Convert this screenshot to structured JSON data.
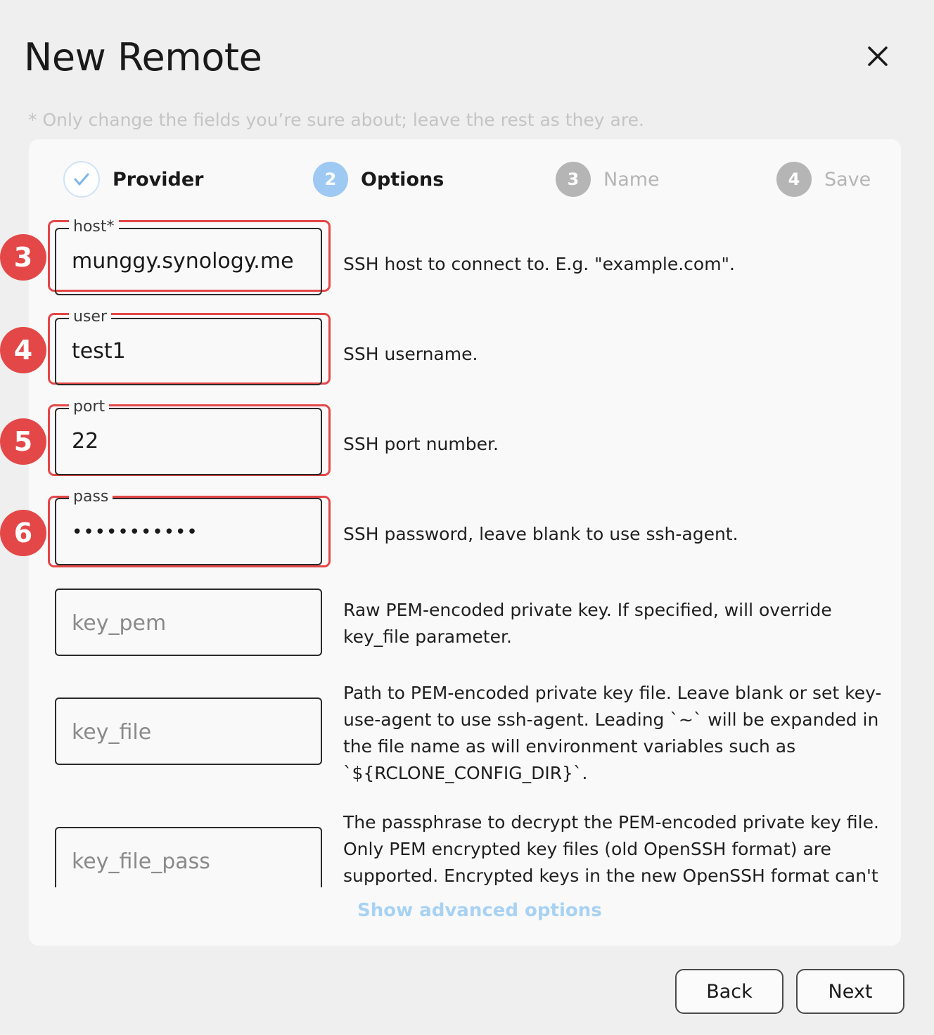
{
  "dialog": {
    "title": "New Remote",
    "hint": "* Only change the fields you’re sure about; leave the rest as they are."
  },
  "steps": [
    {
      "label": "Provider",
      "number": "",
      "state": "done"
    },
    {
      "label": "Options",
      "number": "2",
      "state": "active"
    },
    {
      "label": "Name",
      "number": "3",
      "state": "pending"
    },
    {
      "label": "Save",
      "number": "4",
      "state": "pending"
    }
  ],
  "fields": {
    "host": {
      "label": "host*",
      "value": "munggy.synology.me",
      "description": "SSH host to connect to.  E.g. \"example.com\"."
    },
    "user": {
      "label": "user",
      "value": "test1",
      "description": "SSH username."
    },
    "port": {
      "label": "port",
      "value": "22",
      "description": "SSH port number."
    },
    "pass": {
      "label": "pass",
      "value": "•••••••••••",
      "description": "SSH password, leave blank to use ssh-agent."
    },
    "key_pem": {
      "placeholder": "key_pem",
      "description": "Raw PEM-encoded private key.  If specified, will override key_file parameter."
    },
    "key_file": {
      "placeholder": "key_file",
      "description": "Path to PEM-encoded private key file.  Leave blank or set key-use-agent to use ssh-agent.  Leading `~` will be expanded in the file name as will environment variables such as `${RCLONE_CONFIG_DIR}`."
    },
    "key_file_pass": {
      "placeholder": "key_file_pass",
      "description": "The passphrase to decrypt the PEM-encoded private key file. Only PEM encrypted key files (old OpenSSH format) are supported. Encrypted keys in the new OpenSSH format can't"
    }
  },
  "annotations": [
    "3",
    "4",
    "5",
    "6"
  ],
  "links": {
    "show_advanced": "Show advanced options"
  },
  "buttons": {
    "back": "Back",
    "next": "Next"
  },
  "colors": {
    "accent": "#9dc9f3",
    "annotation": "#e44747",
    "link": "#a8d2f3"
  }
}
